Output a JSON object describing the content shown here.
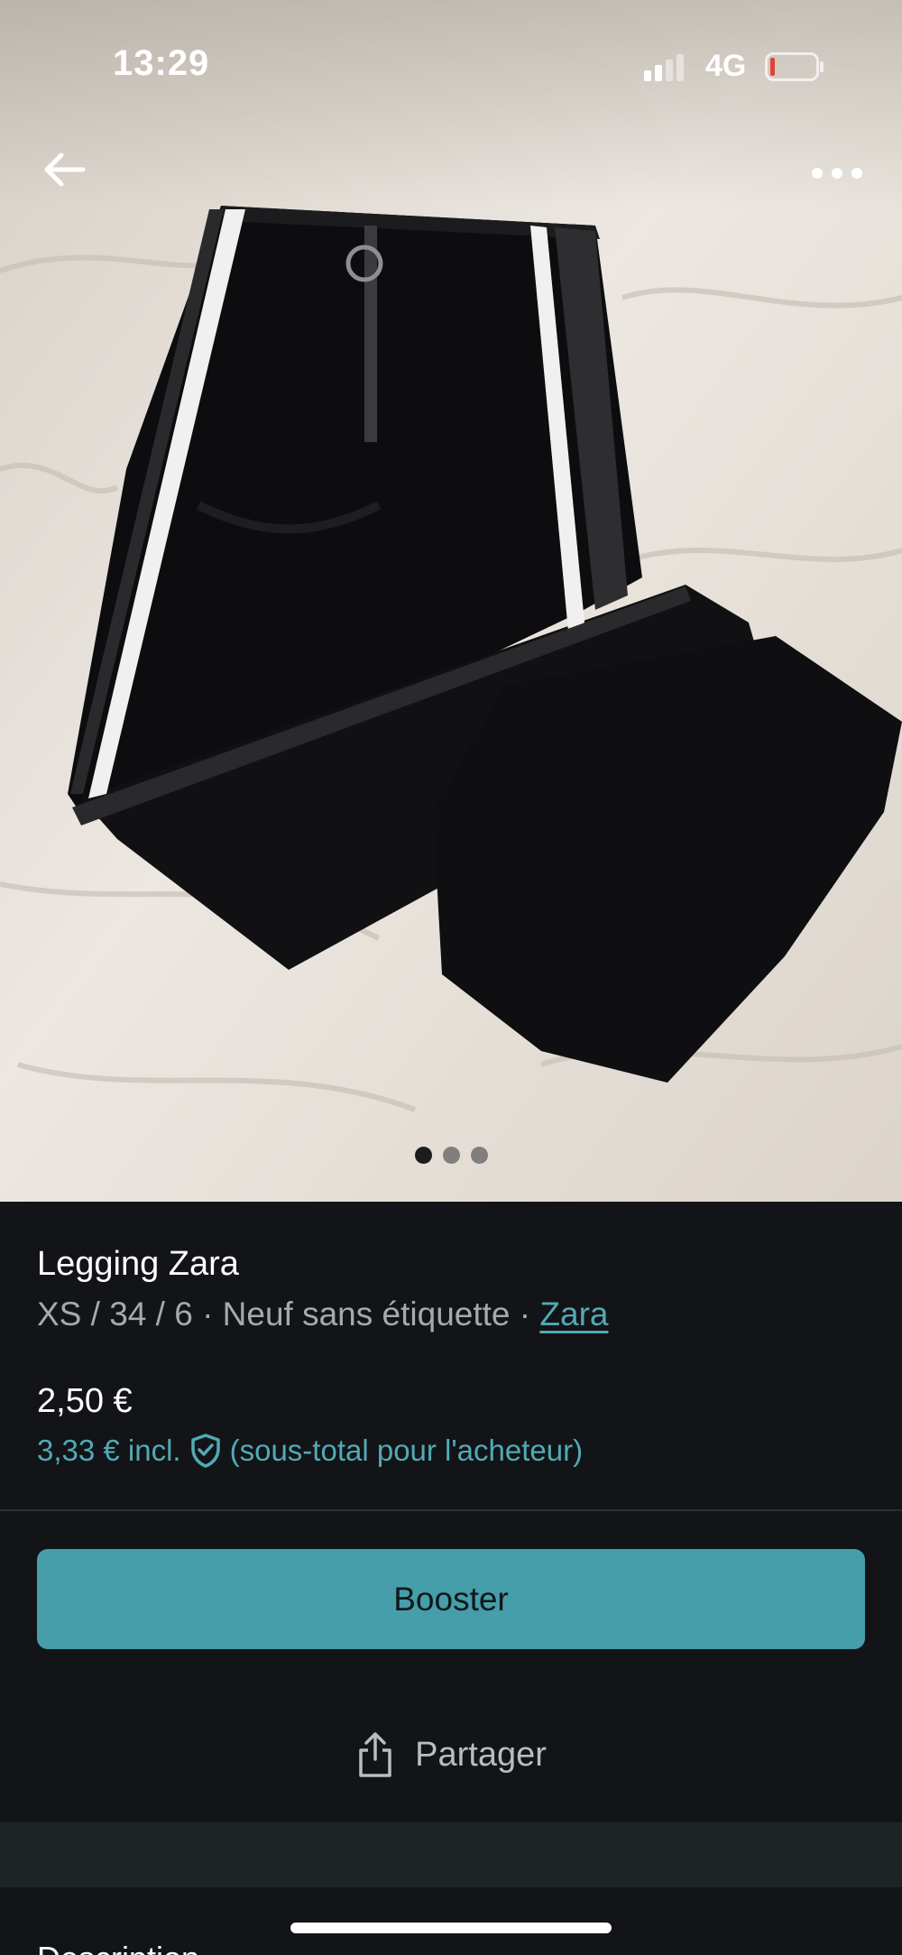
{
  "status_bar": {
    "time": "13:29",
    "network": "4G",
    "battery_color": "#e0403a"
  },
  "nav": {
    "back_icon": "arrow-left-icon",
    "more_icon": "more-horizontal-icon"
  },
  "gallery": {
    "image_description": "black leggings with white stripes on bedsheet",
    "page_count": 3,
    "active_page": 1
  },
  "product": {
    "title": "Legging Zara",
    "size": "XS / 34 / 6",
    "separator": "·",
    "condition": "Neuf sans étiquette",
    "brand": "Zara",
    "price": "2,50 €",
    "price_incl": "3,33 € incl.",
    "price_incl_note": "(sous-total pour l'acheteur)"
  },
  "actions": {
    "booster_label": "Booster",
    "share_label": "Partager"
  },
  "description": {
    "heading": "Description"
  },
  "colors": {
    "accent": "#459ea9",
    "link": "#52aab5",
    "background": "#121417"
  }
}
